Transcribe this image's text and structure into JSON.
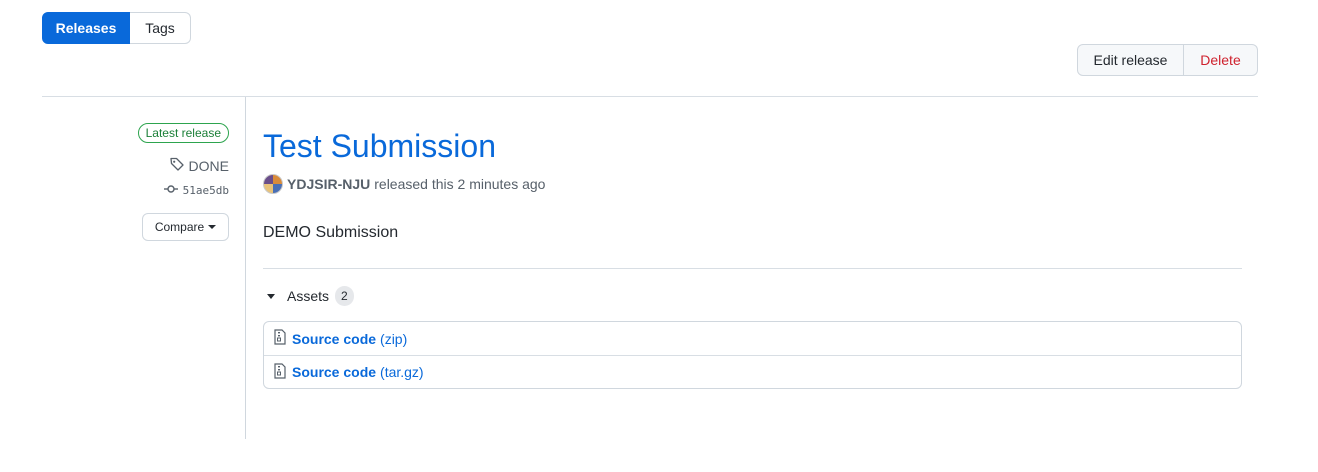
{
  "tabs": {
    "releases": "Releases",
    "tags": "Tags"
  },
  "actions": {
    "edit": "Edit release",
    "delete": "Delete"
  },
  "sidebar": {
    "latest_badge": "Latest release",
    "tag": "DONE",
    "commit": "51ae5db",
    "compare": "Compare"
  },
  "release": {
    "title": "Test Submission",
    "author": "YDJSIR-NJU",
    "released_text": "released this 2 minutes ago",
    "body": "DEMO Submission"
  },
  "assets": {
    "label": "Assets",
    "count": "2",
    "items": [
      {
        "name": "Source code",
        "ext": "(zip)"
      },
      {
        "name": "Source code",
        "ext": "(tar.gz)"
      }
    ]
  },
  "colors": {
    "accent": "#0969da",
    "danger": "#cf222e",
    "success": "#1a7f37"
  }
}
